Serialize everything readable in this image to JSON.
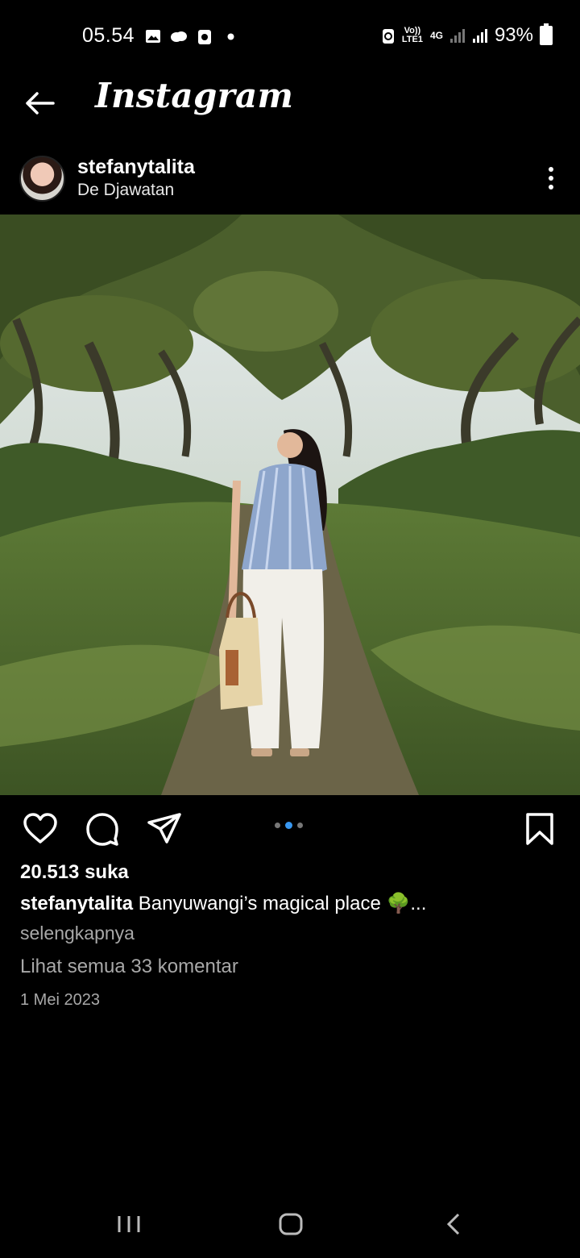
{
  "status_bar": {
    "time": "05.54",
    "network_label_1": "Vo)) LTE1",
    "network_label_2": "4G",
    "battery": "93%"
  },
  "header": {
    "app_name": "Instagram"
  },
  "post": {
    "username": "stefanytalita",
    "location": "De Djawatan",
    "carousel": {
      "count": 3,
      "active_index": 1
    },
    "likes": "20.513 suka",
    "caption_user": "stefanytalita",
    "caption_text": "Banyuwangi’s magical place 🌳...",
    "more_label": "selengkapnya",
    "comments_label": "Lihat semua 33 komentar",
    "date": "1 Mei 2023"
  },
  "colors": {
    "background": "#000000",
    "text": "#ffffff",
    "secondary_text": "#a8a8a8",
    "carousel_active": "#3897f0"
  }
}
